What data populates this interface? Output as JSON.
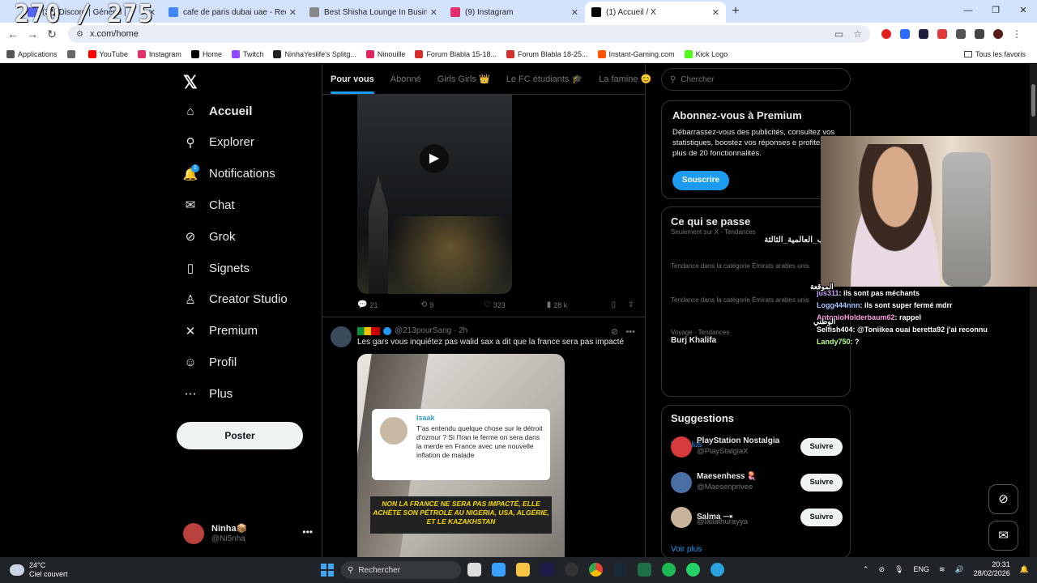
{
  "overlay": {
    "counter": "270 / 275",
    "chat": [
      {
        "user": "jus311",
        "msg": "ils sont pas méchants",
        "color": "#c9a7ff"
      },
      {
        "user": "Logg444nnn",
        "msg": "ils sont super fermé mdrr",
        "color": "#a4c8ff"
      },
      {
        "user": "AntonioHolderbaum62",
        "msg": "rappel",
        "color": "#ff9ce6"
      },
      {
        "user": "Selfish404",
        "msg": "@Toniikea ouai beretta92 j'ai reconnu",
        "color": "#ffffff"
      },
      {
        "user": "Landy750",
        "msg": "?",
        "color": "#b6ff8a"
      }
    ],
    "chat_arabic_top": "الموقعة",
    "chat_arabic_mid": "الوطني"
  },
  "browser": {
    "tabs": [
      {
        "title": "(34) Discord | Général |",
        "color": "#5865f2",
        "active": false
      },
      {
        "title": "cafe de paris dubai uae - Reche",
        "color": "#4285f4",
        "active": false
      },
      {
        "title": "Best Shisha Lounge In Business",
        "color": "#888888",
        "active": false
      },
      {
        "title": "(9) Instagram",
        "color": "#e1306c",
        "active": false
      },
      {
        "title": "(1) Accueil / X",
        "color": "#000000",
        "active": true
      }
    ],
    "newtab": "+",
    "url": "x.com/home",
    "bookmarks": [
      {
        "label": "Applications",
        "color": "#555555"
      },
      {
        "label": "",
        "color": "#666666"
      },
      {
        "label": "YouTube",
        "color": "#ff0000"
      },
      {
        "label": "Instagram",
        "color": "#e1306c"
      },
      {
        "label": "Home",
        "color": "#000000"
      },
      {
        "label": "Twitch",
        "color": "#9146ff"
      },
      {
        "label": "NinhaYeslife's Splitg...",
        "color": "#222222"
      },
      {
        "label": "Ninouille",
        "color": "#e0245e"
      },
      {
        "label": "Forum Blabla 15-18...",
        "color": "#d32f2f"
      },
      {
        "label": "Forum Blabla 18-25...",
        "color": "#d32f2f"
      },
      {
        "label": "Instant-Gaming.com",
        "color": "#ff5400"
      },
      {
        "label": "Kick Logo",
        "color": "#53fc18"
      }
    ],
    "bookmarks_right": "Tous les favoris"
  },
  "x": {
    "nav": [
      {
        "label": "Accueil",
        "icon": "home-icon",
        "glyph": "⌂",
        "bold": true
      },
      {
        "label": "Explorer",
        "icon": "search-icon",
        "glyph": "⚲",
        "bold": false
      },
      {
        "label": "Notifications",
        "icon": "bell-icon",
        "glyph": "🔔",
        "bold": false
      },
      {
        "label": "Chat",
        "icon": "mail-icon",
        "glyph": "✉",
        "bold": false
      },
      {
        "label": "Grok",
        "icon": "grok-icon",
        "glyph": "⊘",
        "bold": false
      },
      {
        "label": "Signets",
        "icon": "bookmark-icon",
        "glyph": "▯",
        "bold": false
      },
      {
        "label": "Creator Studio",
        "icon": "creator-studio-icon",
        "glyph": "♙",
        "bold": false
      },
      {
        "label": "Premium",
        "icon": "x-premium-icon",
        "glyph": "✕",
        "bold": false
      },
      {
        "label": "Profil",
        "icon": "profile-icon",
        "glyph": "☺",
        "bold": false
      },
      {
        "label": "Plus",
        "icon": "more-icon",
        "glyph": "⋯",
        "bold": false
      }
    ],
    "notif_badge": "1",
    "post_button": "Poster",
    "account": {
      "name": "Ninha📦",
      "handle": "@Ni5nha"
    },
    "feed_tabs": [
      "Pour vous",
      "Abonné",
      "Girls Girls 👑",
      "Le FC étudiants 🎓",
      "La famine 😊"
    ],
    "tweet1_actions": {
      "replies": "21",
      "reposts": "9",
      "likes": "323",
      "views": "28 k"
    },
    "tweet2": {
      "handle": "@213pourSang",
      "time": "2h",
      "text": "Les gars vous inquiétez pas walid sax a dit que la france sera pas impacté",
      "quote_name": "Isaak",
      "quote_text": "T'as entendu quelque chose sur le détroit d'ozmur ? Si l'Iran le ferme on sera dans la merde en France avec une nouvelle inflation de malade",
      "banner": "NON LA FRANCE NE SERA PAS IMPACTÉ, ELLE ACHÈTE SON PÉTROLE AU NIGERIA, USA, ALGÉRIE, ET LE KAZAKHSTAN"
    },
    "search_placeholder": "Chercher",
    "premium": {
      "title": "Abonnez-vous à Premium",
      "text": "Débarrassez-vous des publicités, consultez vos statistiques, boostez vos réponses e profitez de plus de 20 fonctionnalités.",
      "button": "Souscrire"
    },
    "trends": {
      "title": "Ce qui se passe",
      "items": [
        {
          "context": "Seulement sur X · Tendances",
          "name": "ب_العالمية_الثالثة"
        },
        {
          "context": "Tendance dans la catégorie Émirats arabes unis",
          "name": ""
        },
        {
          "context": "Tendance dans la catégorie Émirats arabes unis",
          "name": ""
        },
        {
          "context": "Voyage · Tendances",
          "name": "Burj Khalifa"
        }
      ],
      "more": "Voir plus"
    },
    "suggestions": {
      "title": "Suggestions",
      "items": [
        {
          "name": "PlayStation Nostalgia",
          "handle": "@PlayStalgiaX",
          "button": "Suivre",
          "color": "#d63a3a"
        },
        {
          "name": "Maesenhess 🪼",
          "handle": "@Maesenprivee",
          "button": "Suivre",
          "color": "#4a6fa5"
        },
        {
          "name": "Salma 🝐",
          "handle": "@lallathurayya",
          "button": "Suivre",
          "color": "#c8b49a"
        }
      ],
      "more": "Voir plus"
    }
  },
  "taskbar": {
    "temp": "24°C",
    "weather": "Ciel couvert",
    "search": "Rechercher",
    "lang": "ENG",
    "time": "20:31",
    "date": "28/02/2026"
  }
}
